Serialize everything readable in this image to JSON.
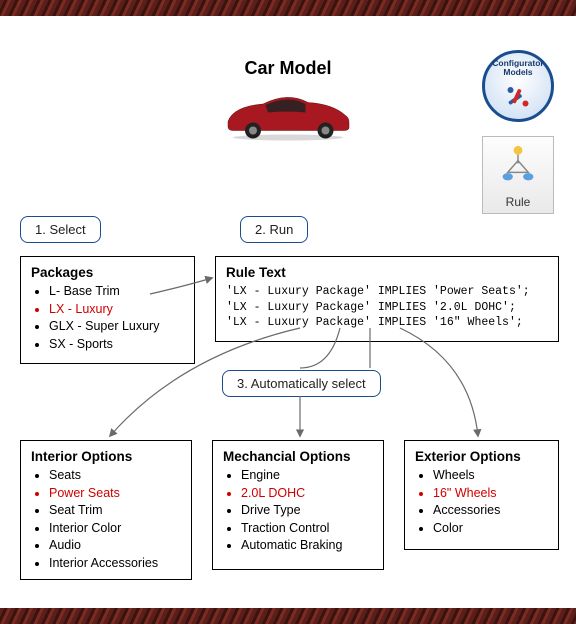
{
  "title": "Car Model",
  "configurator_label": "Configurator\nModels",
  "rule_box_label": "Rule",
  "steps": {
    "s1": "1. Select",
    "s2": "2. Run",
    "s3": "3. Automatically select"
  },
  "packages": {
    "title": "Packages",
    "items": [
      {
        "text": "L- Base Trim",
        "hl": false
      },
      {
        "text": "LX - Luxury",
        "hl": true
      },
      {
        "text": "GLX - Super Luxury",
        "hl": false
      },
      {
        "text": "SX - Sports",
        "hl": false
      }
    ]
  },
  "rule_text": {
    "title": "Rule Text",
    "lines": [
      "'LX - Luxury Package' IMPLIES 'Power Seats';",
      "'LX - Luxury Package' IMPLIES '2.0L DOHC';",
      "'LX - Luxury Package' IMPLIES '16\" Wheels';"
    ]
  },
  "interior": {
    "title": "Interior Options",
    "items": [
      {
        "text": "Seats",
        "hl": false
      },
      {
        "text": "Power Seats",
        "hl": true
      },
      {
        "text": "Seat Trim",
        "hl": false
      },
      {
        "text": "Interior Color",
        "hl": false
      },
      {
        "text": "Audio",
        "hl": false
      },
      {
        "text": "Interior Accessories",
        "hl": false
      }
    ]
  },
  "mechanical": {
    "title": "Mechancial Options",
    "items": [
      {
        "text": "Engine",
        "hl": false
      },
      {
        "text": "2.0L DOHC",
        "hl": true
      },
      {
        "text": "Drive Type",
        "hl": false
      },
      {
        "text": "Traction Control",
        "hl": false
      },
      {
        "text": "Automatic Braking",
        "hl": false
      }
    ]
  },
  "exterior": {
    "title": "Exterior Options",
    "items": [
      {
        "text": "Wheels",
        "hl": false
      },
      {
        "text": "16\" Wheels",
        "hl": true
      },
      {
        "text": "Accessories",
        "hl": false
      },
      {
        "text": "Color",
        "hl": false
      }
    ]
  }
}
